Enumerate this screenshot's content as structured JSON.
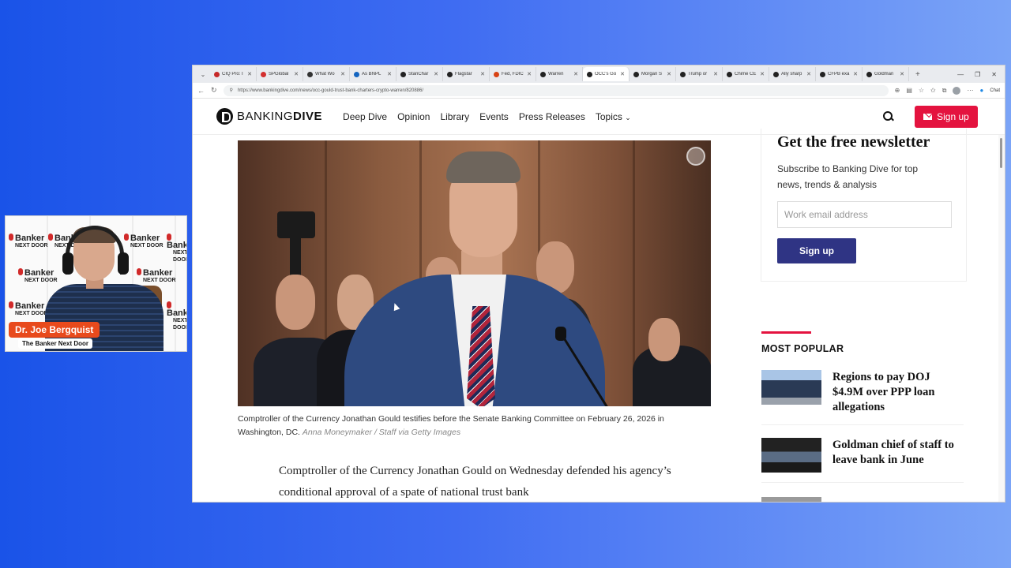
{
  "webcam": {
    "name": "Dr. Joe Bergquist",
    "show": "The Banker Next Door",
    "backdrop_logo": "Banker",
    "backdrop_logo_sub": "NEXT DOOR"
  },
  "browser": {
    "tabs": [
      {
        "label": "CIQ Pro: I",
        "color": "#c62828"
      },
      {
        "label": "SPGlobal",
        "color": "#d32f2f"
      },
      {
        "label": "What Wo",
        "color": "#333333"
      },
      {
        "label": "As BNPL",
        "color": "#1565c0"
      },
      {
        "label": "StanChar",
        "color": "#222222"
      },
      {
        "label": "Flagstar",
        "color": "#222222"
      },
      {
        "label": "Fed, FDIC",
        "color": "#d84315"
      },
      {
        "label": "Warren",
        "color": "#222222"
      },
      {
        "label": "OCC's Go",
        "color": "#222222",
        "active": true
      },
      {
        "label": "Morgan S",
        "color": "#222222"
      },
      {
        "label": "Trump or",
        "color": "#222222"
      },
      {
        "label": "Chime CE",
        "color": "#222222"
      },
      {
        "label": "Ally sharp",
        "color": "#222222"
      },
      {
        "label": "CFPB exa",
        "color": "#222222"
      },
      {
        "label": "Goldman",
        "color": "#222222"
      }
    ],
    "url": "https://www.bankingdive.com/news/occ-gould-trust-bank-charters-crypto-warren/820886/",
    "chat_label": "Chat"
  },
  "site": {
    "brand_light": "BANKING",
    "brand_bold": "DIVE",
    "nav": [
      "Deep Dive",
      "Opinion",
      "Library",
      "Events",
      "Press Releases",
      "Topics"
    ],
    "signup_label": "Sign up"
  },
  "article": {
    "caption": "Comptroller of the Currency Jonathan Gould testifies before the Senate Banking Committee on February 26, 2026 in Washington, DC.",
    "credit": "Anna Moneymaker / Staff via Getty Images",
    "lead": "Comptroller of the Currency Jonathan Gould on Wednesday defended his agency’s conditional approval of a spate of national trust bank"
  },
  "newsletter": {
    "title": "Get the free newsletter",
    "subtitle": "Subscribe to Banking Dive for top news, trends & analysis",
    "placeholder": "Work email address",
    "button": "Sign up"
  },
  "most_popular": {
    "heading": "MOST POPULAR",
    "items": [
      {
        "title": "Regions to pay DOJ $4.9M over PPP loan allegations"
      },
      {
        "title": "Goldman chief of staff to leave bank in June"
      }
    ]
  }
}
